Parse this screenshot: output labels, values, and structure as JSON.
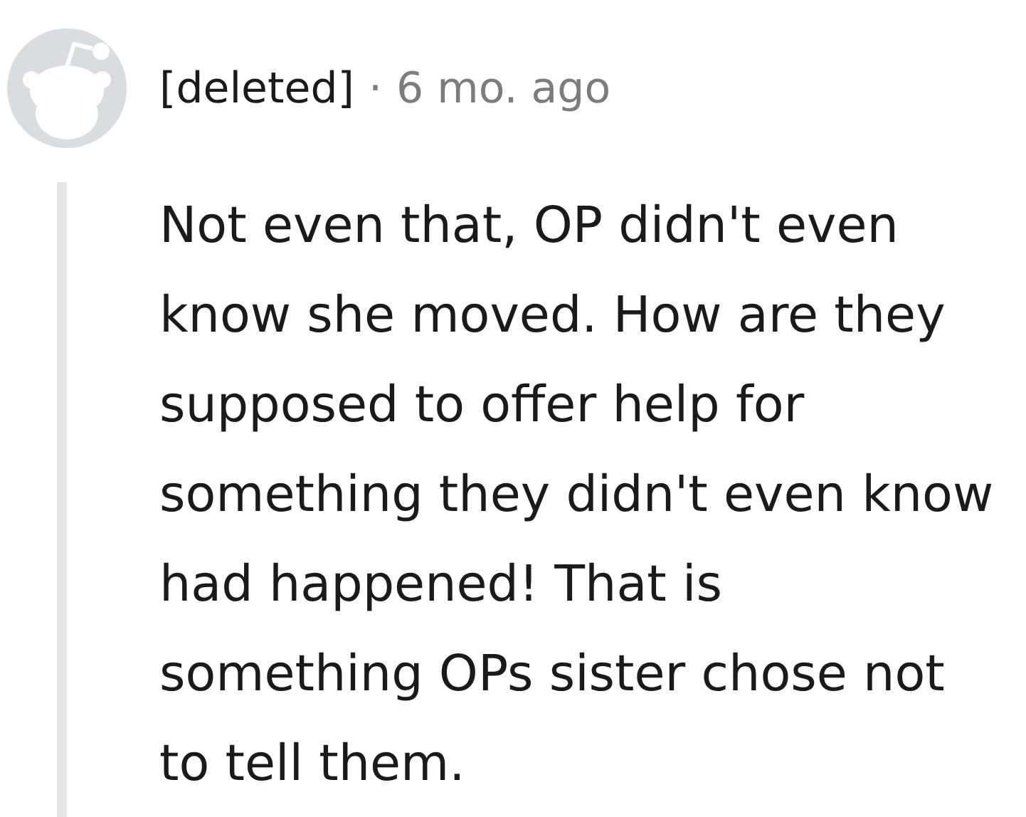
{
  "comment": {
    "author": "[deleted]",
    "separator": "·",
    "time": "6 mo. ago",
    "body": "Not even that, OP didn't even know she moved. How are they supposed to offer help for something they didn't even know had happened! That is something OPs sister chose not to tell them."
  }
}
